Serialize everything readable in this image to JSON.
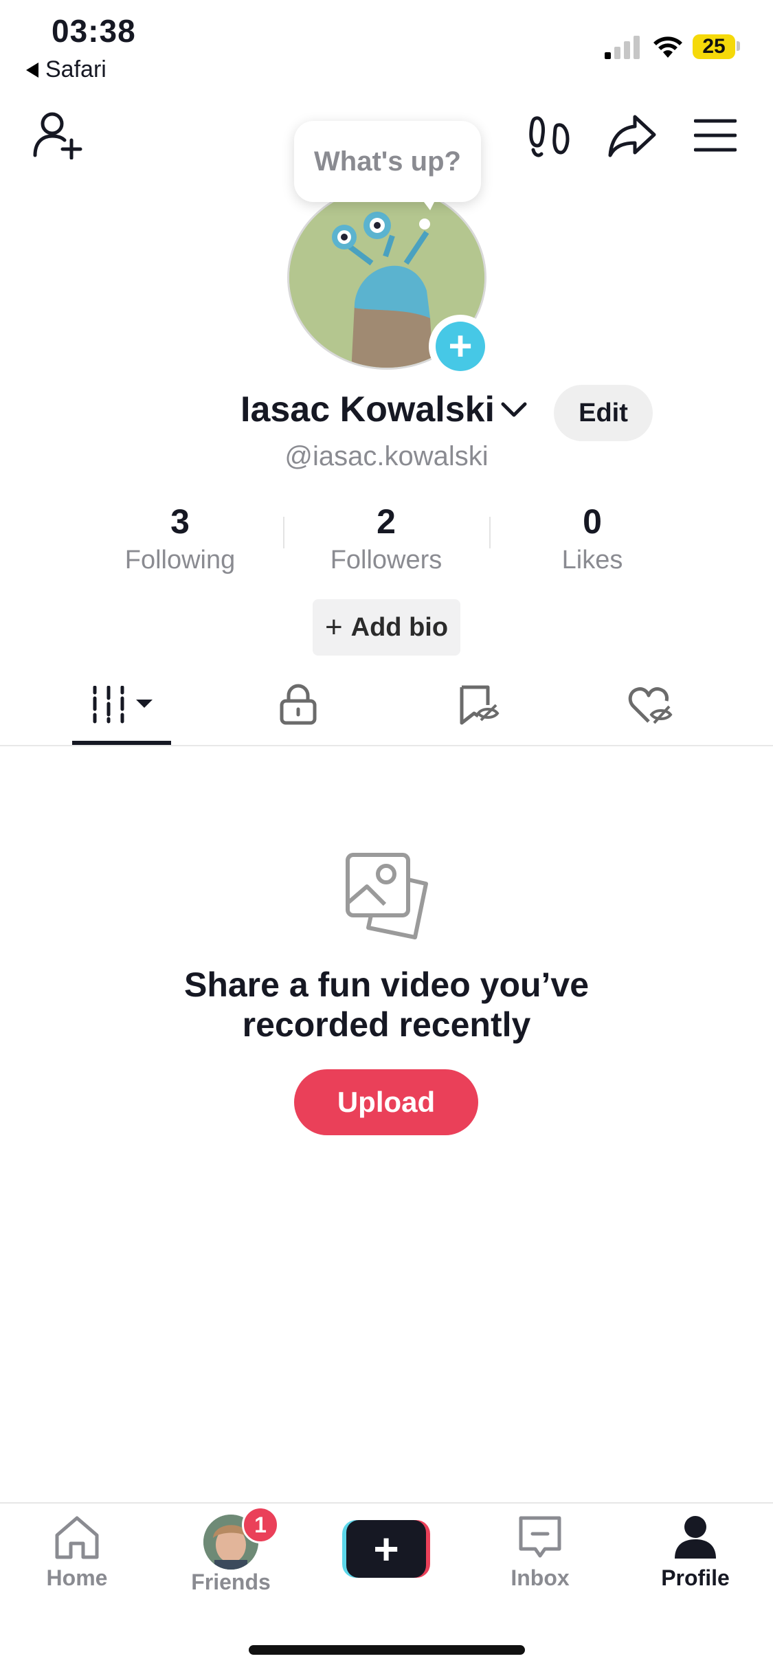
{
  "status_bar": {
    "time": "03:38",
    "back_app": "Safari",
    "battery": "25"
  },
  "profile": {
    "tooltip": "What's up?",
    "name": "Iasac Kowalski",
    "handle": "@iasac.kowalski",
    "edit_label": "Edit",
    "add_bio_label": "Add bio",
    "stats": [
      {
        "value": "3",
        "label": "Following"
      },
      {
        "value": "2",
        "label": "Followers"
      },
      {
        "value": "0",
        "label": "Likes"
      }
    ]
  },
  "empty_state": {
    "title_line1": "Share a fun video you’ve",
    "title_line2": "recorded recently",
    "upload_label": "Upload"
  },
  "bottom_nav": {
    "items": [
      {
        "label": "Home"
      },
      {
        "label": "Friends",
        "badge": "1"
      },
      {
        "label": ""
      },
      {
        "label": "Inbox"
      },
      {
        "label": "Profile"
      }
    ]
  },
  "colors": {
    "accent": "#ea4059",
    "cyan": "#46c8e6",
    "text": "#161823",
    "muted": "#8a8b91"
  }
}
